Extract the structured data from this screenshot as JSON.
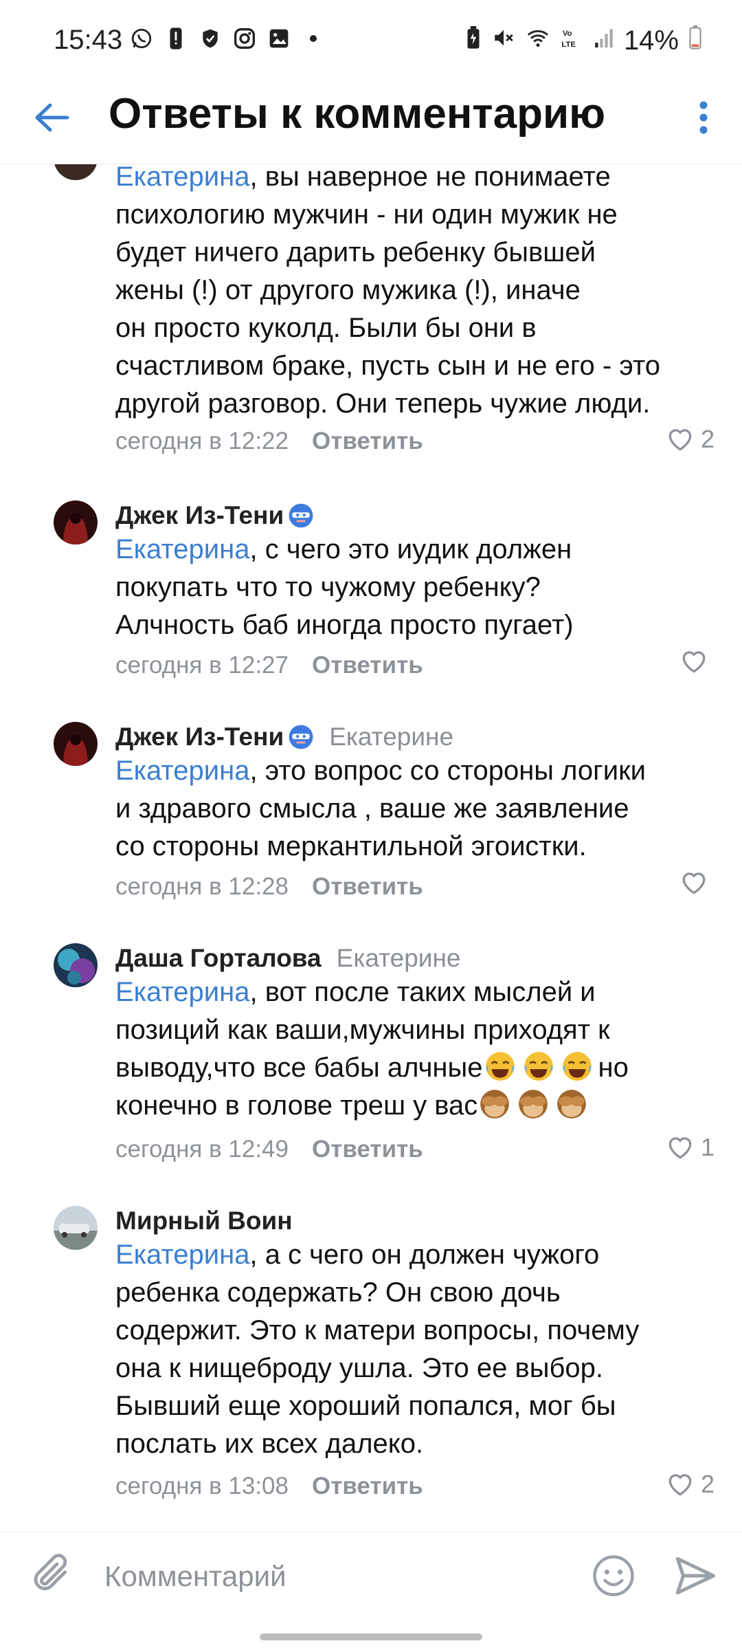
{
  "status_bar": {
    "time": "15:43",
    "battery": "14%"
  },
  "header": {
    "title": "Ответы к комментарию"
  },
  "comments": [
    {
      "mention": "Екатерина",
      "text": ", вы наверное не понимаете\nпсихологию мужчин - ни один мужик не\nбудет ничего дарить ребенку бывшей\nжены (!) от другого мужика (!), иначе\nон просто куколд. Были бы они в\nсчастливом браке, пусть сын и не его - это\nдругой разговор. Они теперь чужие люди.",
      "time": "сегодня в 12:22",
      "reply_label": "Ответить",
      "likes": "2"
    },
    {
      "author": "Джек Из-Тени",
      "mention": "Екатерина",
      "text": ", с чего это иудик должен\nпокупать что то чужому ребенку?\nАлчность баб иногда просто пугает)",
      "time": "сегодня в 12:27",
      "reply_label": "Ответить",
      "likes": ""
    },
    {
      "author": "Джек Из-Тени",
      "reply_to": "Екатерине",
      "mention": "Екатерина",
      "text": ", это вопрос со стороны логики\nи здравого смысла , ваше же заявление\nсо стороны меркантильной эгоистки.",
      "time": "сегодня в 12:28",
      "reply_label": "Ответить",
      "likes": ""
    },
    {
      "author": "Даша Горталова",
      "reply_to": "Екатерине",
      "mention": "Екатерина",
      "text_a": ", вот после таких мыслей и\nпозиций как ваши,мужчины приходят к\nвыводу,что все бабы алчные",
      "text_b": "но\nконечно в голове треш у вас",
      "time": "сегодня в 12:49",
      "reply_label": "Ответить",
      "likes": "1"
    },
    {
      "author": "Мирный Воин",
      "mention": "Екатерина",
      "text": ", а с чего он должен чужого\nребенка содержать? Он свою дочь\nсодержит. Это к матери вопросы, почему\nона к нищеброду ушла. Это ее выбор.\nБывший еще хороший попался, мог бы\nпослать их всех далеко.",
      "time": "сегодня в 13:08",
      "reply_label": "Ответить",
      "likes": "2"
    }
  ],
  "composer": {
    "placeholder": "Комментарий"
  },
  "colors": {
    "accent": "#3a7fd0",
    "muted": "#8d9299"
  },
  "icons": [
    "back-arrow-icon",
    "more-vertical-icon",
    "heart-icon",
    "paperclip-icon",
    "smile-icon",
    "send-icon",
    "laughing-emoji-icon",
    "see-no-evil-monkey-emoji-icon"
  ]
}
